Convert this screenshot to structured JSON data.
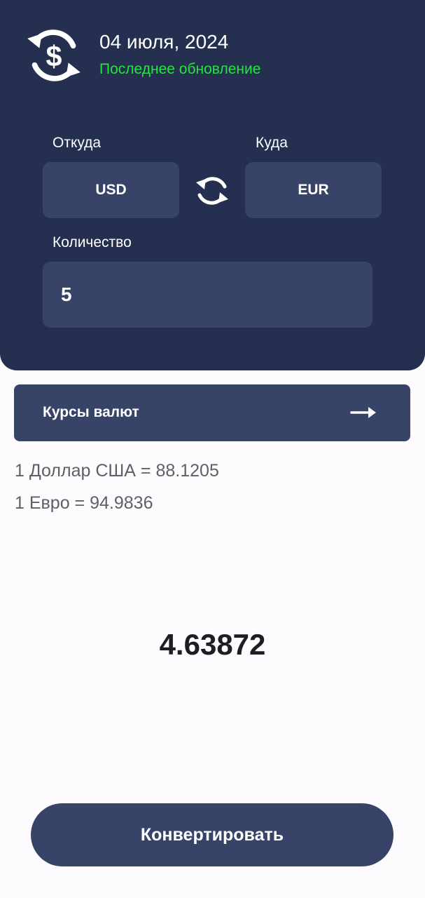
{
  "header": {
    "app_icon": "currency-exchange-icon",
    "date": "04 июля, 2024",
    "last_update": "Последнее обновление",
    "colors": {
      "header_bg": "#252f4f",
      "field_bg": "#384467",
      "update_text": "#22e63c"
    }
  },
  "converter": {
    "from_label": "Откуда",
    "to_label": "Куда",
    "from_currency": "USD",
    "to_currency": "EUR",
    "swap_icon": "swap-arrows-icon",
    "amount_label": "Количество",
    "amount_value": "5"
  },
  "rates": {
    "title": "Курсы валют",
    "arrow_icon": "arrow-right-icon",
    "lines": [
      "1 Доллар США = 88.1205",
      "1 Евро = 94.9836"
    ]
  },
  "result": {
    "value": "4.63872"
  },
  "actions": {
    "convert_label": "Конвертировать"
  }
}
